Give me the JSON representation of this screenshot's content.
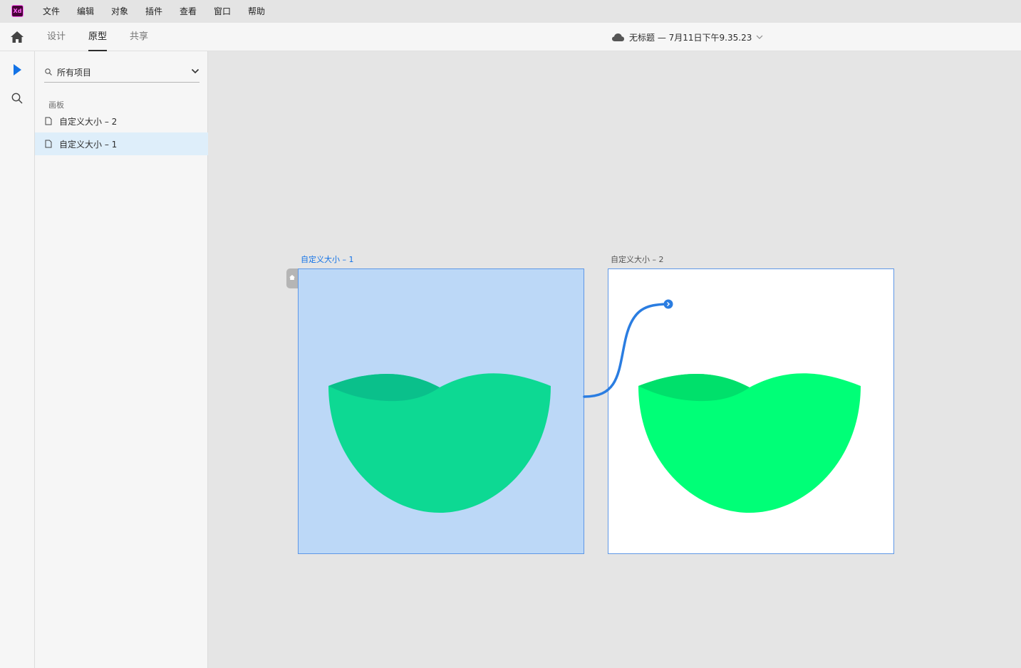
{
  "app": {
    "logo_text": "Xd",
    "brand_color": "#ff61f6"
  },
  "menu": {
    "items": [
      "文件",
      "编辑",
      "对象",
      "插件",
      "查看",
      "窗口",
      "帮助"
    ]
  },
  "tabs": {
    "home_icon": "home-icon",
    "items": [
      {
        "label": "设计",
        "active": false
      },
      {
        "label": "原型",
        "active": true
      },
      {
        "label": "共享",
        "active": false
      }
    ]
  },
  "document": {
    "title": "无标题 — 7月11日下午9.35.23",
    "cloud_icon": "cloud-icon"
  },
  "tools": [
    {
      "name": "select-tool",
      "icon": "arrow-pointer-icon",
      "active": true
    },
    {
      "name": "zoom-tool",
      "icon": "search-icon",
      "active": false
    }
  ],
  "panel": {
    "filter_label": "所有项目",
    "section_title": "画板",
    "artboards": [
      {
        "label": "自定义大小 – 2",
        "selected": false
      },
      {
        "label": "自定义大小 – 1",
        "selected": true
      }
    ]
  },
  "canvas": {
    "artboards": [
      {
        "label": "自定义大小 – 1",
        "background": "#bcd8f7",
        "fill_light": "#0dd993",
        "fill_dark": "#0ac08b",
        "is_home": true,
        "selected": true
      },
      {
        "label": "自定义大小 – 2",
        "background": "#ffffff",
        "fill_light": "#00ff77",
        "fill_dark": "#00e06b",
        "is_home": false,
        "selected": false
      }
    ],
    "wire_color": "#2a7de1"
  }
}
